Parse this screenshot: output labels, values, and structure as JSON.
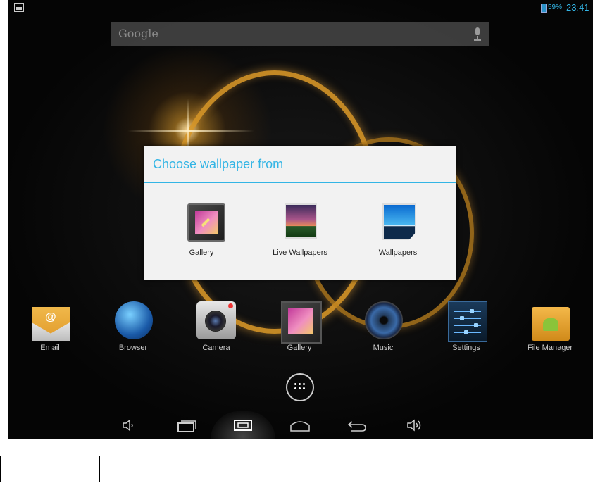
{
  "status_bar": {
    "battery_percent": "59%",
    "time": "23:41",
    "notification_icon": "image-icon",
    "accent": "#33b5e5"
  },
  "search": {
    "brand": "Google",
    "mic_icon": "microphone-icon"
  },
  "dialog": {
    "title": "Choose wallpaper from",
    "options": [
      {
        "label": "Gallery",
        "icon": "gallery-icon"
      },
      {
        "label": "Live Wallpapers",
        "icon": "live-wallpapers-icon"
      },
      {
        "label": "Wallpapers",
        "icon": "wallpapers-icon"
      }
    ]
  },
  "dock": {
    "apps": [
      {
        "label": "Email",
        "icon": "email-icon"
      },
      {
        "label": "Browser",
        "icon": "browser-icon"
      },
      {
        "label": "Camera",
        "icon": "camera-icon"
      },
      {
        "label": "Gallery",
        "icon": "gallery-icon"
      },
      {
        "label": "Music",
        "icon": "music-icon"
      },
      {
        "label": "Settings",
        "icon": "settings-icon"
      },
      {
        "label": "File Manager",
        "icon": "folder-icon"
      }
    ],
    "all_apps_icon": "app-drawer-icon"
  },
  "nav_bar": {
    "buttons": [
      "volume-down-icon",
      "recent-apps-icon",
      "screenshot-icon",
      "home-icon",
      "back-icon",
      "volume-up-icon"
    ]
  }
}
